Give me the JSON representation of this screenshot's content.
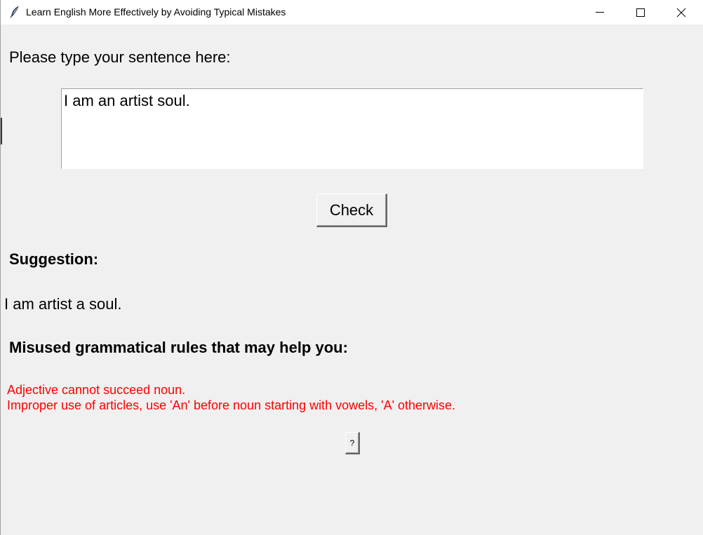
{
  "window": {
    "title": "Learn English More Effectively by Avoiding Typical Mistakes",
    "app_icon": "feather-icon",
    "controls": {
      "minimize": "minimize-icon",
      "maximize": "maximize-icon",
      "close": "close-icon"
    }
  },
  "form": {
    "prompt_label": "Please type your sentence here:",
    "sentence_value": "I am an artist soul.",
    "check_label": "Check"
  },
  "result": {
    "suggestion_heading": "Suggestion:",
    "suggestion_text": "I am artist a soul.",
    "rules_heading": "Misused grammatical rules that may help you:",
    "rules": [
      "Adjective cannot succeed noun.",
      "Improper use of articles, use 'An' before noun starting with vowels, 'A' otherwise."
    ],
    "rules_color": "#ff0000",
    "help_label": "?"
  }
}
